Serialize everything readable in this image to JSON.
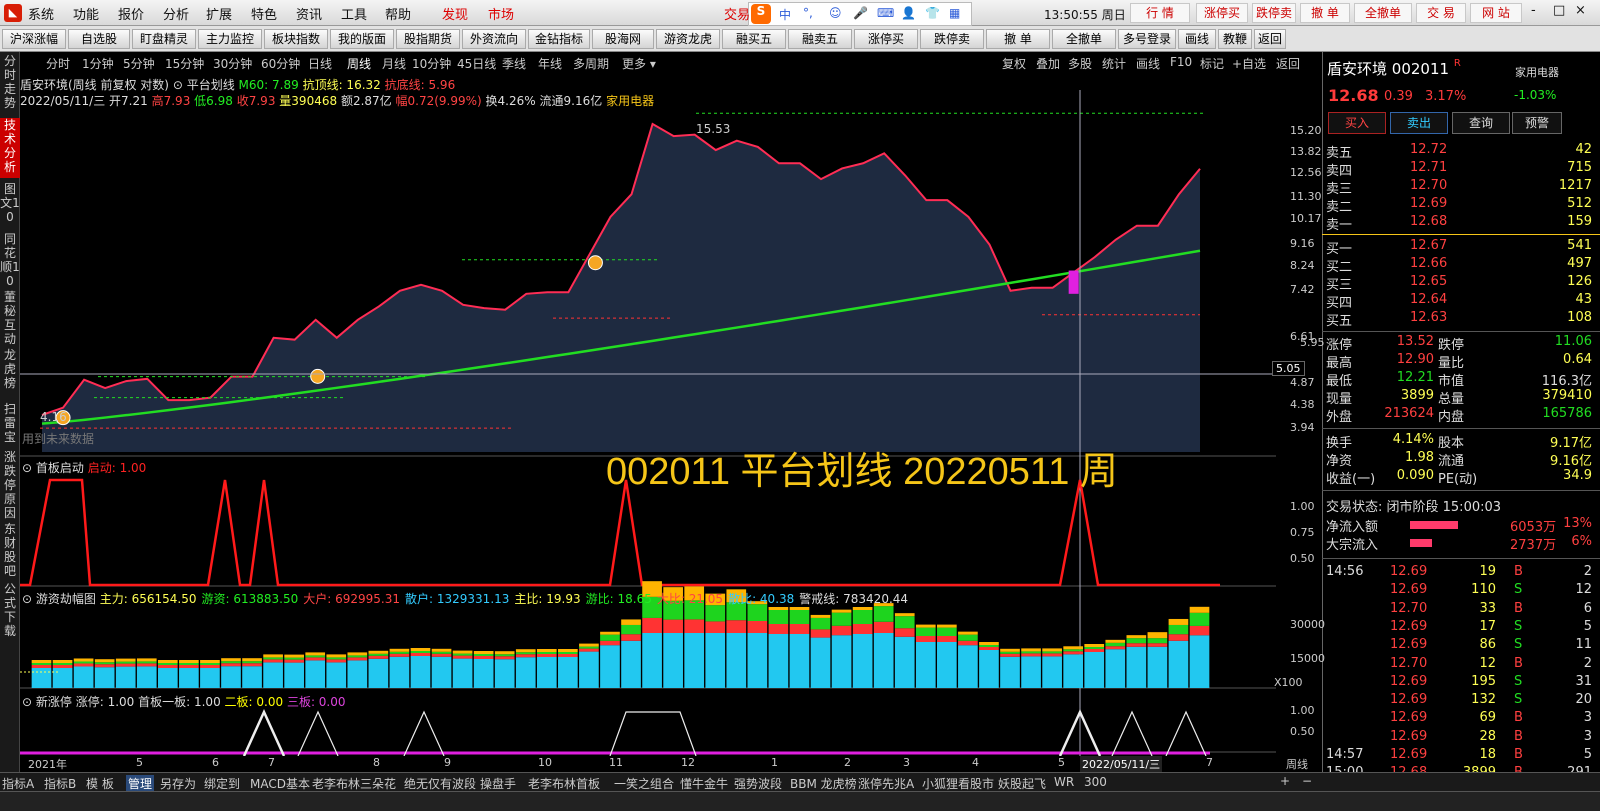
{
  "menubar": {
    "items": [
      "系统",
      "功能",
      "报价",
      "分析",
      "扩展",
      "特色",
      "资讯",
      "工具",
      "帮助"
    ],
    "discover": "发现",
    "market": "市场",
    "trade_partial": "交易",
    "clock": "13:50:55 周日",
    "right_buttons": [
      "行  情",
      "涨停买",
      "跌停卖",
      "撤  单",
      "全撤单",
      "交  易",
      "网  站"
    ],
    "win": [
      "-",
      "□",
      "×"
    ]
  },
  "ime": {
    "logo": "S",
    "items": [
      "中",
      "°,",
      "☺",
      "🎤",
      "⌨",
      "👤",
      "👕",
      "▦"
    ]
  },
  "toolbar": [
    "沪深涨幅",
    "自选股",
    "盯盘精灵",
    "主力监控",
    "板块指数",
    "我的版面",
    "股指期货",
    "外资流向",
    "金钻指标",
    "股海网",
    "游资龙虎",
    "融买五",
    "融卖五",
    "涨停买",
    "跌停卖",
    "撤  单",
    "全撤单",
    "多号登录",
    "画线",
    "教鞭",
    "返回"
  ],
  "leftbar": [
    "分时走势",
    "技术分析",
    "图文10",
    "同花顺10",
    "董秘互动",
    "龙虎榜",
    "扫雷宝",
    "涨跌停原因",
    "东财股吧",
    "公式下载"
  ],
  "periods": [
    "分时",
    "1分钟",
    "5分钟",
    "15分钟",
    "30分钟",
    "60分钟",
    "日线",
    "周线",
    "月线",
    "10分钟",
    "45日线",
    "季线",
    "年线",
    "多周期",
    "更多 ▾"
  ],
  "chart_tools": [
    "复权",
    "叠加",
    "多股",
    "统计",
    "画线",
    "F10",
    "标记",
    "+自选",
    "返回"
  ],
  "info": {
    "name": "盾安环境(周线 前复权 对数)",
    "indicator": "平台划线",
    "m60": "M60: 7.89",
    "top_line": "抗顶线: 16.32",
    "bottom_line": "抗底线: 5.96",
    "date": "2022/05/11/三",
    "open": "开7.21",
    "high": "高7.93",
    "low": "低6.98",
    "close": "收7.93",
    "vol": "量390468",
    "amount": "额2.87亿",
    "amp": "幅0.72(9.99%)",
    "turnover": "换4.26%",
    "float": "流通9.16亿",
    "sector": "家用电器",
    "future": "用到未来数据"
  },
  "main_axis": [
    "15.20",
    "13.82",
    "12.56",
    "11.30",
    "10.17",
    "9.16",
    "8.24",
    "7.42",
    "6.61",
    "5.95",
    "5.41",
    "4.87",
    "4.38",
    "3.94"
  ],
  "crosshair_price": "5.05",
  "price_annotations": {
    "high": "15.53",
    "low": "4.16"
  },
  "big_title": "002011 平台划线 20220511 周",
  "panel2": {
    "title": "首板启动",
    "label": "启动: 1.00",
    "axis": [
      "1.00",
      "0.75",
      "0.50"
    ]
  },
  "panel3": {
    "title": "游资劫幅图",
    "values": "主力: 656154.50  游资: 613883.50  大户: 692995.31  散户: 1329331.13  主比: 19.93  游比: 18.65  大比: 21.05  散比: 40.38  警戒线: 783420.44",
    "axis": [
      "30000",
      "15000",
      "X100"
    ]
  },
  "panel4": {
    "title": "新涨停",
    "label1": "涨停: 1.00",
    "label2": "首板一板: 1.00",
    "label3": "二板: 0.00",
    "label4": "三板: 0.00",
    "axis": [
      "1.00",
      "0.50"
    ]
  },
  "xaxis": [
    "2021年",
    "5",
    "6",
    "7",
    "8",
    "9",
    "10",
    "11",
    "12",
    "1",
    "2",
    "3",
    "4",
    "5",
    "2022/05/11/三",
    "7"
  ],
  "xaxis_right": "周线",
  "quote": {
    "name": "盾安环境",
    "code": "002011",
    "r": "R",
    "industry": "家用电器",
    "industry_chg": "-1.03%",
    "price": "12.68",
    "chg": "0.39",
    "pct": "3.17%",
    "buttons": [
      "买入",
      "卖出",
      "查询",
      "预警"
    ],
    "sells": [
      [
        "卖五",
        "12.72",
        "42"
      ],
      [
        "卖四",
        "12.71",
        "715"
      ],
      [
        "卖三",
        "12.70",
        "1217"
      ],
      [
        "卖二",
        "12.69",
        "512"
      ],
      [
        "卖一",
        "12.68",
        "159"
      ]
    ],
    "buys": [
      [
        "买一",
        "12.67",
        "541"
      ],
      [
        "买二",
        "12.66",
        "497"
      ],
      [
        "买三",
        "12.65",
        "126"
      ],
      [
        "买四",
        "12.64",
        "43"
      ],
      [
        "买五",
        "12.63",
        "108"
      ]
    ],
    "stats": [
      [
        "涨停",
        "13.52",
        "跌停",
        "11.06"
      ],
      [
        "最高",
        "12.90",
        "量比",
        "0.64"
      ],
      [
        "最低",
        "12.21",
        "市值",
        "116.3亿"
      ],
      [
        "现量",
        "3899",
        "总量",
        "379410"
      ],
      [
        "外盘",
        "213624",
        "内盘",
        "165786"
      ]
    ],
    "stats2": [
      [
        "换手",
        "4.14%",
        "股本",
        "9.17亿"
      ],
      [
        "净资",
        "1.98",
        "流通",
        "9.16亿"
      ],
      [
        "收益(一)",
        "0.090",
        "PE(动)",
        "34.9"
      ]
    ],
    "status": "交易状态: 闭市阶段 15:00:03",
    "flows": [
      [
        "净流入额",
        "6053万",
        "13%"
      ],
      [
        "大宗流入",
        "2737万",
        "6%"
      ]
    ],
    "ticks": [
      [
        "14:56",
        "12.69",
        "19",
        "B",
        "2"
      ],
      [
        "",
        "12.69",
        "110",
        "S",
        "12"
      ],
      [
        "",
        "12.70",
        "33",
        "B",
        "6"
      ],
      [
        "",
        "12.69",
        "17",
        "S",
        "5"
      ],
      [
        "",
        "12.69",
        "86",
        "S",
        "11"
      ],
      [
        "",
        "12.70",
        "12",
        "B",
        "2"
      ],
      [
        "",
        "12.69",
        "195",
        "S",
        "31"
      ],
      [
        "",
        "12.69",
        "132",
        "S",
        "20"
      ],
      [
        "",
        "12.69",
        "69",
        "B",
        "3"
      ],
      [
        "",
        "12.69",
        "28",
        "B",
        "3"
      ],
      [
        "14:57",
        "12.69",
        "18",
        "B",
        "5"
      ],
      [
        "15:00",
        "12.68",
        "3899",
        "B",
        "291"
      ]
    ]
  },
  "bottom_tabs": [
    "指标A",
    "指标B",
    "模 板",
    "管理",
    "另存为",
    "绑定到",
    "MACD基本",
    "老李布林",
    "三朵花",
    "绝无仅有波段",
    "操盘手",
    "老李布林首板",
    "一笑之组合",
    "懂牛金牛",
    "强势波段",
    "BBM 龙虎榜",
    "涨停先兆A",
    "小狐狸看股市",
    "妖股起飞",
    "WR",
    "300"
  ],
  "chart_data": {
    "type": "line",
    "title": "002011 平台划线 20220511 周",
    "price": [
      4.16,
      4.3,
      4.88,
      4.7,
      4.85,
      4.9,
      4.45,
      4.45,
      4.5,
      4.95,
      4.95,
      5.9,
      5.85,
      6.4,
      5.9,
      6.4,
      6.8,
      7.3,
      7.5,
      7.3,
      6.85,
      6.75,
      6.7,
      7.2,
      7.25,
      7.25,
      8.6,
      10.2,
      11.3,
      15.53,
      14.7,
      14.8,
      13.8,
      14.4,
      14.0,
      13.0,
      13.0,
      12.1,
      12.7,
      13.0,
      13.6,
      12.3,
      11.0,
      11.0,
      10.2,
      9.0,
      7.3,
      7.4,
      7.4,
      7.93,
      8.5,
      9.2,
      9.8,
      9.8,
      11.3,
      12.68
    ],
    "m60_last": 7.89,
    "ylim": [
      3.94,
      15.53
    ]
  }
}
